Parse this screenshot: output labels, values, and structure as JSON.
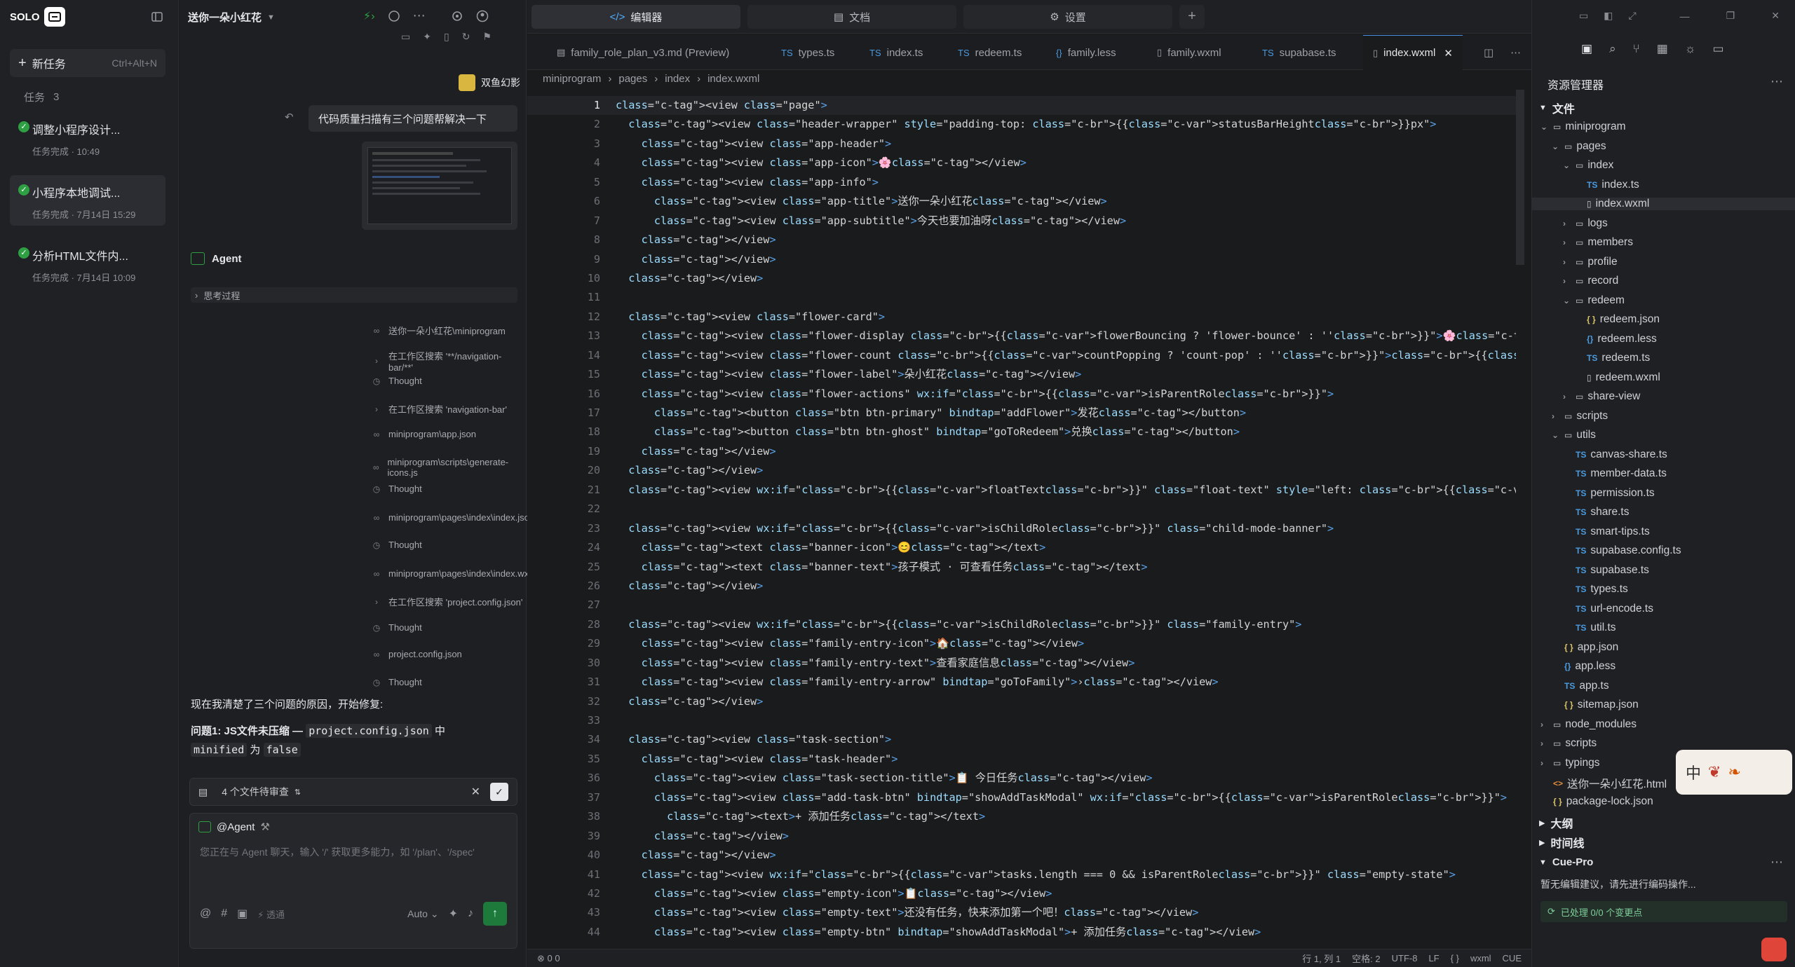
{
  "app": {
    "logo": "SOLO",
    "new_task": "新任务",
    "new_task_shortcut": "Ctrl+Alt+N",
    "tasks_label": "任务",
    "tasks_count": "3"
  },
  "tasks": [
    {
      "title": "调整小程序设计...",
      "status": "任务完成 · 10:49"
    },
    {
      "title": "小程序本地调试...",
      "status": "任务完成 · 7月14日 15:29"
    },
    {
      "title": "分析HTML文件内...",
      "status": "任务完成 · 7月14日 10:09"
    }
  ],
  "chat": {
    "project_title": "送你一朵小红花",
    "user_name": "双鱼幻影",
    "user_message": "代码质量扫描有三个问题帮解决一下",
    "agent_label": "Agent",
    "thinking": "思考过程",
    "steps": [
      {
        "icon": "glasses",
        "text": "送你一朵小红花\\miniprogram"
      },
      {
        "icon": "chevron",
        "text": "在工作区搜索 '**/navigation-bar/**'"
      },
      {
        "icon": "clock",
        "text": "Thought"
      },
      {
        "icon": "chevron",
        "text": "在工作区搜索 'navigation-bar'"
      },
      {
        "icon": "glasses",
        "text": "miniprogram\\app.json"
      },
      {
        "icon": "glasses",
        "text": "miniprogram\\scripts\\generate-icons.js"
      },
      {
        "icon": "clock",
        "text": "Thought"
      },
      {
        "icon": "glasses",
        "text": "miniprogram\\pages\\index\\index.json"
      },
      {
        "icon": "clock",
        "text": "Thought"
      },
      {
        "icon": "glasses",
        "text": "miniprogram\\pages\\index\\index.wxml"
      },
      {
        "icon": "chevron",
        "text": "在工作区搜索 'project.config.json'"
      },
      {
        "icon": "clock",
        "text": "Thought"
      },
      {
        "icon": "glasses",
        "text": "project.config.json"
      },
      {
        "icon": "clock",
        "text": "Thought"
      }
    ],
    "summary": "现在我清楚了三个问题的原因，开始修复:",
    "issue_title": "问题1: JS文件未压缩 — ",
    "issue_code1": "project.config.json",
    "issue_mid": " 中",
    "issue_code2": "minified",
    "issue_word": " 为 ",
    "issue_code3": "false",
    "pending_files": "4 个文件待审查",
    "at_agent": "@Agent",
    "input_placeholder": "您正在与 Agent 聊天，输入 '/' 获取更多能力，如 '/plan'、'/spec'",
    "tools_label": "透通",
    "mode": "Auto"
  },
  "editor": {
    "top_tabs": [
      {
        "label": "编辑器",
        "icon": "code"
      },
      {
        "label": "文档",
        "icon": "doc"
      },
      {
        "label": "设置",
        "icon": "gear"
      }
    ],
    "file_tabs": [
      {
        "label": "family_role_plan_v3.md (Preview)",
        "icon": "md"
      },
      {
        "label": "types.ts",
        "icon": "TS"
      },
      {
        "label": "index.ts",
        "icon": "TS"
      },
      {
        "label": "redeem.ts",
        "icon": "TS"
      },
      {
        "label": "family.less",
        "icon": "{}"
      },
      {
        "label": "family.wxml",
        "icon": "file"
      },
      {
        "label": "supabase.ts",
        "icon": "TS"
      },
      {
        "label": "index.wxml",
        "icon": "file",
        "active": true
      }
    ],
    "breadcrumb": [
      "miniprogram",
      "pages",
      "index",
      "index.wxml"
    ],
    "lines": [
      "<view class=\"page\">",
      "  <view class=\"header-wrapper\" style=\"padding-top: {{statusBarHeight}}px\">",
      "    <view class=\"app-header\">",
      "    <view class=\"app-icon\">🌸</view>",
      "    <view class=\"app-info\">",
      "      <view class=\"app-title\">送你一朵小红花</view>",
      "      <view class=\"app-subtitle\">今天也要加油呀</view>",
      "    </view>",
      "    </view>",
      "  </view>",
      "",
      "  <view class=\"flower-card\">",
      "    <view class=\"flower-display {{flowerBouncing ? 'flower-bounce' : ''}}\">🌸</view>",
      "    <view class=\"flower-count {{countPopping ? 'count-pop' : ''}}\">{{flowerCount}}</view>",
      "    <view class=\"flower-label\">朵小红花</view>",
      "    <view class=\"flower-actions\" wx:if=\"{{isParentRole}}\">",
      "      <button class=\"btn btn-primary\" bindtap=\"addFlower\">发花</button>",
      "      <button class=\"btn btn-ghost\" bindtap=\"goToRedeem\">兑换</button>",
      "    </view>",
      "  </view>",
      "  <view wx:if=\"{{floatText}}\" class=\"float-text\" style=\"left: {{floatX}}px; top: {{floatY}}px;\">{{floatText}}</view>",
      "",
      "  <view wx:if=\"{{isChildRole}}\" class=\"child-mode-banner\">",
      "    <text class=\"banner-icon\">😊</text>",
      "    <text class=\"banner-text\">孩子模式 · 可查看任务</text>",
      "  </view>",
      "",
      "  <view wx:if=\"{{isChildRole}}\" class=\"family-entry\">",
      "    <view class=\"family-entry-icon\">🏠</view>",
      "    <view class=\"family-entry-text\">查看家庭信息</view>",
      "    <view class=\"family-entry-arrow\" bindtap=\"goToFamily\">›</view>",
      "  </view>",
      "",
      "  <view class=\"task-section\">",
      "    <view class=\"task-header\">",
      "      <view class=\"task-section-title\">📋 今日任务</view>",
      "      <view class=\"add-task-btn\" bindtap=\"showAddTaskModal\" wx:if=\"{{isParentRole}}\">",
      "        <text>+ 添加任务</text>",
      "      </view>",
      "    </view>",
      "    <view wx:if=\"{{tasks.length === 0 && isParentRole}}\" class=\"empty-state\">",
      "      <view class=\"empty-icon\">📋</view>",
      "      <view class=\"empty-text\">还没有任务，快来添加第一个吧！</view>",
      "      <view class=\"empty-btn\" bindtap=\"showAddTaskModal\">+ 添加任务</view>"
    ],
    "status_left": "0  0",
    "status_right": [
      "行 1, 列 1",
      "空格: 2",
      "UTF-8",
      "LF",
      "{ }",
      "wxml",
      "CUE"
    ]
  },
  "explorer": {
    "title": "资源管理器",
    "files_section": "文件",
    "tree": [
      {
        "d": 0,
        "t": "folder-open",
        "label": "miniprogram"
      },
      {
        "d": 1,
        "t": "folder-open",
        "label": "pages"
      },
      {
        "d": 2,
        "t": "folder-open",
        "label": "index"
      },
      {
        "d": 3,
        "t": "ts",
        "label": "index.ts"
      },
      {
        "d": 3,
        "t": "file",
        "label": "index.wxml",
        "active": true
      },
      {
        "d": 2,
        "t": "folder",
        "label": "logs"
      },
      {
        "d": 2,
        "t": "folder",
        "label": "members"
      },
      {
        "d": 2,
        "t": "folder",
        "label": "profile"
      },
      {
        "d": 2,
        "t": "folder",
        "label": "record"
      },
      {
        "d": 2,
        "t": "folder-open",
        "label": "redeem"
      },
      {
        "d": 3,
        "t": "json",
        "label": "redeem.json"
      },
      {
        "d": 3,
        "t": "less",
        "label": "redeem.less"
      },
      {
        "d": 3,
        "t": "ts",
        "label": "redeem.ts"
      },
      {
        "d": 3,
        "t": "file",
        "label": "redeem.wxml"
      },
      {
        "d": 2,
        "t": "folder",
        "label": "share-view"
      },
      {
        "d": 1,
        "t": "folder",
        "label": "scripts"
      },
      {
        "d": 1,
        "t": "folder-open",
        "label": "utils"
      },
      {
        "d": 2,
        "t": "ts",
        "label": "canvas-share.ts"
      },
      {
        "d": 2,
        "t": "ts",
        "label": "member-data.ts"
      },
      {
        "d": 2,
        "t": "ts",
        "label": "permission.ts"
      },
      {
        "d": 2,
        "t": "ts",
        "label": "share.ts"
      },
      {
        "d": 2,
        "t": "ts",
        "label": "smart-tips.ts"
      },
      {
        "d": 2,
        "t": "ts",
        "label": "supabase.config.ts"
      },
      {
        "d": 2,
        "t": "ts",
        "label": "supabase.ts"
      },
      {
        "d": 2,
        "t": "ts",
        "label": "types.ts"
      },
      {
        "d": 2,
        "t": "ts",
        "label": "url-encode.ts"
      },
      {
        "d": 2,
        "t": "ts",
        "label": "util.ts"
      },
      {
        "d": 1,
        "t": "json",
        "label": "app.json"
      },
      {
        "d": 1,
        "t": "less",
        "label": "app.less"
      },
      {
        "d": 1,
        "t": "ts",
        "label": "app.ts"
      },
      {
        "d": 1,
        "t": "json",
        "label": "sitemap.json"
      },
      {
        "d": 0,
        "t": "folder",
        "label": "node_modules"
      },
      {
        "d": 0,
        "t": "folder",
        "label": "scripts"
      },
      {
        "d": 0,
        "t": "folder",
        "label": "typings"
      },
      {
        "d": 0,
        "t": "html",
        "label": "送你一朵小红花.html"
      },
      {
        "d": 0,
        "t": "json",
        "label": "package-lock.json"
      }
    ],
    "outline": "大纲",
    "timeline": "时间线",
    "cue_title": "Cue-Pro",
    "cue_text": "暂无编辑建议，请先进行编码操作...",
    "cue_processed": "已处理 0/0 个变更点",
    "ime_label": "中"
  }
}
